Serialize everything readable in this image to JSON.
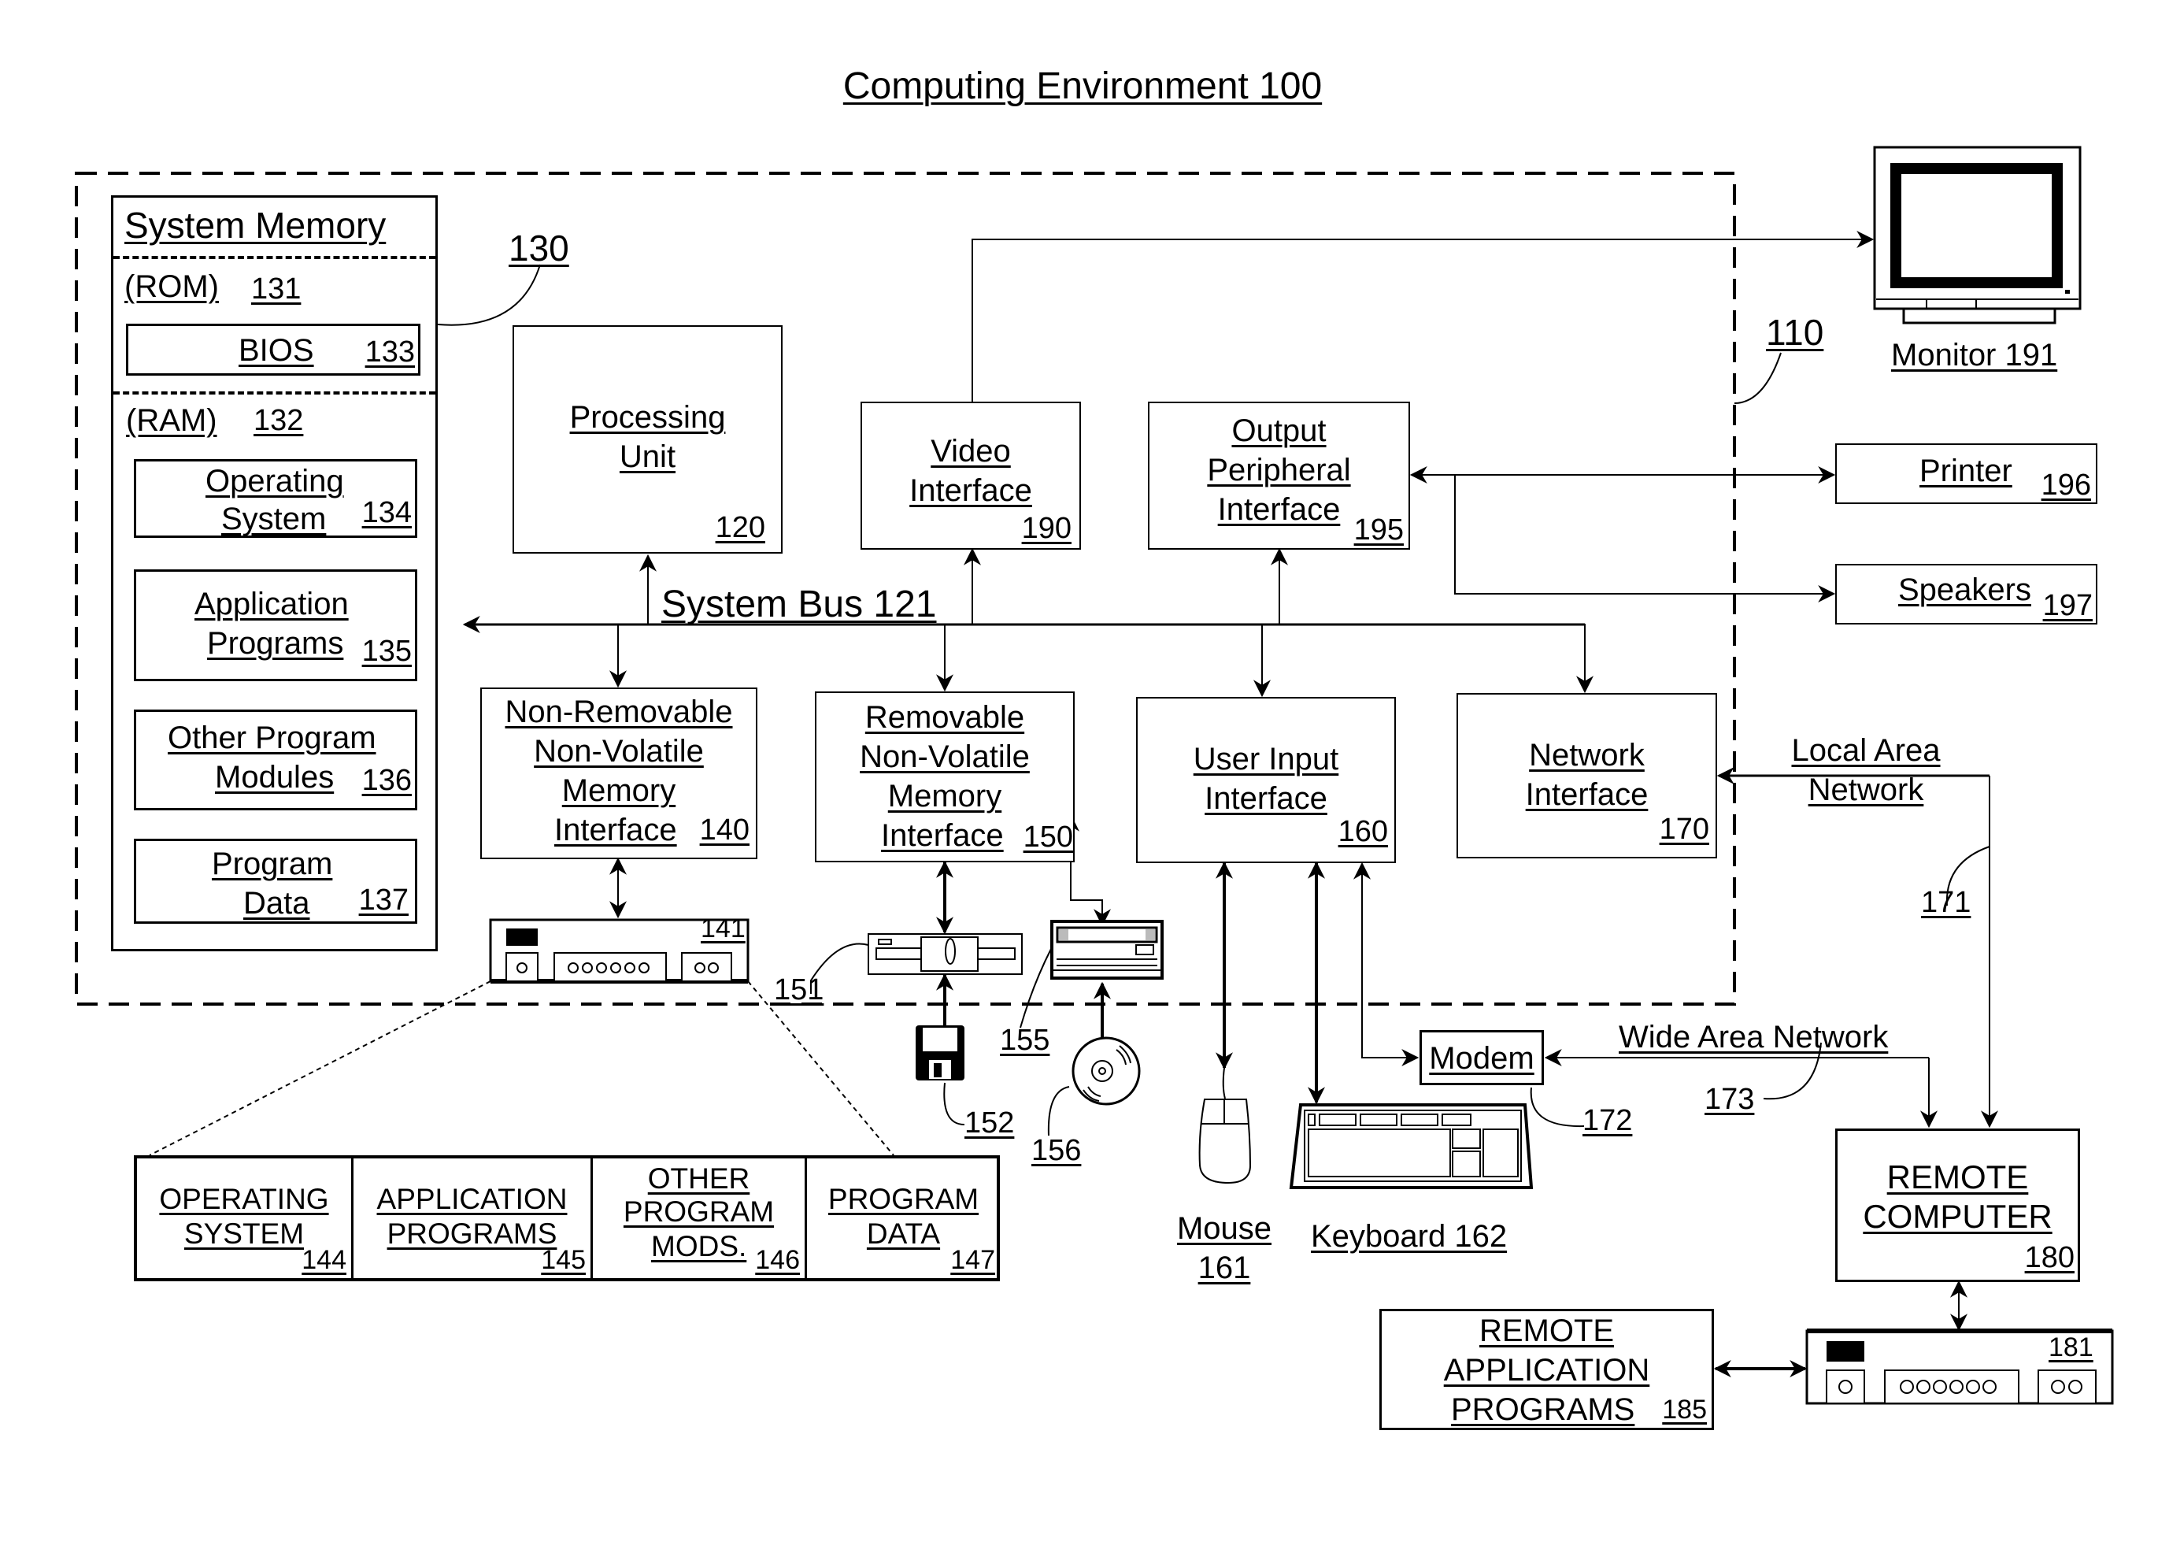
{
  "title": "Computing Environment 100",
  "computer": {
    "ref": "110"
  },
  "system_memory": {
    "title": "System Memory",
    "ref": "130",
    "rom": {
      "label": "(ROM)",
      "ref": "131"
    },
    "bios": {
      "label": "BIOS",
      "ref": "133"
    },
    "ram": {
      "label": "(RAM)",
      "ref": "132"
    },
    "items": [
      {
        "line1": "Operating",
        "line2": "System",
        "ref": "134"
      },
      {
        "line1": "Application",
        "line2": "Programs",
        "ref": "135"
      },
      {
        "line1": "Other Program",
        "line2": "Modules",
        "ref": "136"
      },
      {
        "line1": "Program",
        "line2": "Data",
        "ref": "137"
      }
    ]
  },
  "processing_unit": {
    "line1": "Processing",
    "line2": "Unit",
    "ref": "120"
  },
  "video_interface": {
    "line1": "Video",
    "line2": "Interface",
    "ref": "190"
  },
  "output_peripheral": {
    "line1": "Output",
    "line2": "Peripheral",
    "line3": "Interface",
    "ref": "195"
  },
  "system_bus": {
    "label": "System Bus 121"
  },
  "non_removable": {
    "line1": "Non-Removable",
    "line2": "Non-Volatile",
    "line3": "Memory",
    "line4": "Interface",
    "ref": "140"
  },
  "removable": {
    "line1": "Removable",
    "line2": "Non-Volatile",
    "line3": "Memory",
    "line4": "Interface",
    "ref": "150"
  },
  "user_input": {
    "line1": "User Input",
    "line2": "Interface",
    "ref": "160"
  },
  "network_interface": {
    "line1": "Network",
    "line2": "Interface",
    "ref": "170"
  },
  "monitor": {
    "label": "Monitor 191"
  },
  "printer": {
    "label": "Printer",
    "ref": "196"
  },
  "speakers": {
    "label": "Speakers",
    "ref": "197"
  },
  "hard_disk": {
    "ref": "141"
  },
  "floppy_drive": {
    "ref": "151"
  },
  "floppy_disk": {
    "ref": "152"
  },
  "optical_drive": {
    "ref": "155"
  },
  "optical_disc": {
    "ref": "156"
  },
  "stored_programs": [
    {
      "line1": "OPERATING",
      "line2": "SYSTEM",
      "line3": "",
      "ref": "144"
    },
    {
      "line1": "APPLICATION",
      "line2": "PROGRAMS",
      "line3": "",
      "ref": "145"
    },
    {
      "line1": "OTHER",
      "line2": "PROGRAM",
      "line3": "MODS.",
      "ref": "146"
    },
    {
      "line1": "PROGRAM",
      "line2": "DATA",
      "line3": "",
      "ref": "147"
    }
  ],
  "mouse": {
    "line1": "Mouse",
    "line2": "161"
  },
  "keyboard": {
    "label": "Keyboard 162"
  },
  "modem": {
    "label": "Modem",
    "ref": "172"
  },
  "lan": {
    "line1": "Local Area",
    "line2": "Network",
    "ref": "171"
  },
  "wan": {
    "label": "Wide Area Network",
    "ref": "173"
  },
  "remote_computer": {
    "line1": "REMOTE",
    "line2": "COMPUTER",
    "ref": "180"
  },
  "remote_storage": {
    "ref": "181"
  },
  "remote_apps": {
    "line1": "REMOTE",
    "line2": "APPLICATION",
    "line3": "PROGRAMS",
    "ref": "185"
  }
}
